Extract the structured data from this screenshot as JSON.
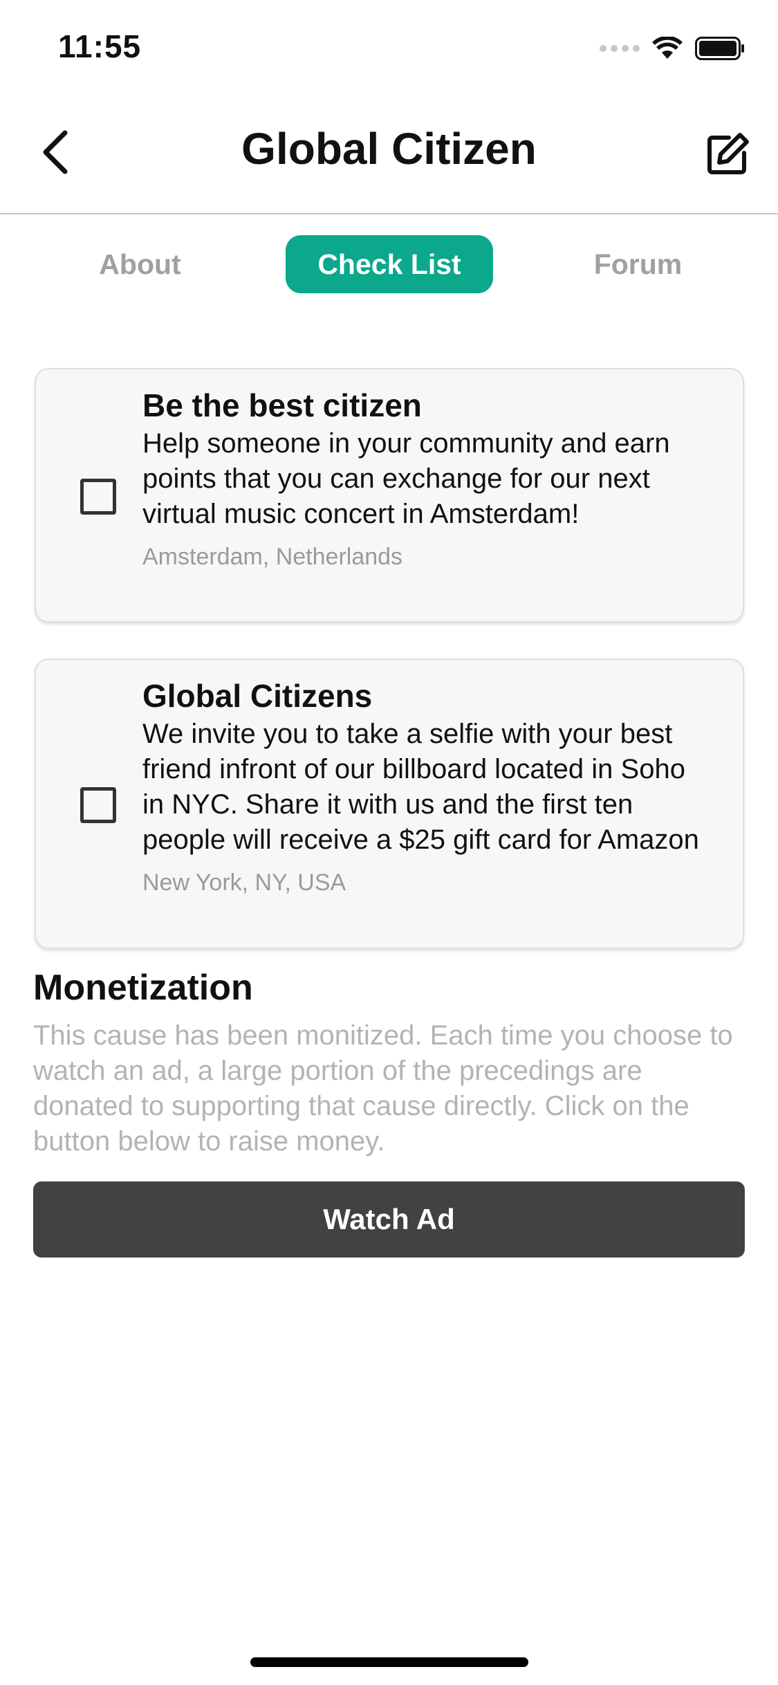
{
  "status_bar": {
    "time": "11:55",
    "icons": [
      "signal-icon",
      "wifi-icon",
      "battery-icon"
    ]
  },
  "nav": {
    "title": "Global Citizen",
    "back_icon": "chevron-left-icon",
    "edit_icon": "edit-icon"
  },
  "tabs": [
    {
      "label": "About",
      "active": false
    },
    {
      "label": "Check List",
      "active": true
    },
    {
      "label": "Forum",
      "active": false
    }
  ],
  "checklist": [
    {
      "title": "Be the best citizen",
      "description": "Help someone in your community and earn points that you can exchange for our next virtual music concert in Amsterdam!",
      "location": "Amsterdam, Netherlands",
      "checked": false
    },
    {
      "title": "Global Citizens",
      "description": "We invite you to take a selfie with your best friend infront of our billboard located in Soho in NYC. Share it with us and the first ten people will receive a $25 gift card for Amazon",
      "location": "New York, NY, USA",
      "checked": false
    }
  ],
  "monetization": {
    "title": "Monetization",
    "description": "This cause has been monitized. Each time you choose to watch an ad, a large portion of the precedings are donated to supporting that cause directly. Click on the button below to raise money.",
    "button_label": "Watch Ad"
  },
  "colors": {
    "accent": "#0ba88b",
    "button_dark": "#424242",
    "muted_text": "#b3b3b3"
  }
}
